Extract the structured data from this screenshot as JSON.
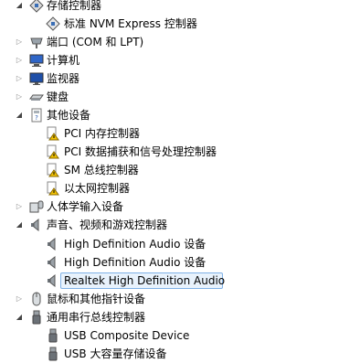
{
  "tree": {
    "storage_controllers": {
      "label": "存储控制器"
    },
    "nvme_controller": {
      "label": "标准 NVM Express 控制器"
    },
    "ports": {
      "label": "端口 (COM 和 LPT)"
    },
    "computer": {
      "label": "计算机"
    },
    "monitors": {
      "label": "监视器"
    },
    "keyboards": {
      "label": "键盘"
    },
    "other_devices": {
      "label": "其他设备"
    },
    "pci_memory": {
      "label": "PCI 内存控制器"
    },
    "pci_data_acq": {
      "label": "PCI 数据捕获和信号处理控制器"
    },
    "sm_bus": {
      "label": "SM 总线控制器"
    },
    "ethernet": {
      "label": "以太网控制器"
    },
    "hid": {
      "label": "人体学输入设备"
    },
    "sound": {
      "label": "声音、视频和游戏控制器"
    },
    "hda_1": {
      "label": "High Definition Audio 设备"
    },
    "hda_2": {
      "label": "High Definition Audio 设备"
    },
    "realtek": {
      "label": "Realtek High Definition Audio"
    },
    "mice": {
      "label": "鼠标和其他指针设备"
    },
    "usb_controllers": {
      "label": "通用串行总线控制器"
    },
    "usb_composite": {
      "label": "USB Composite Device"
    },
    "usb_mass_storage": {
      "label": "USB 大容量存储设备"
    }
  },
  "colors": {
    "selection_fill": "#e8f2fc",
    "selection_border": "#7fb1e6",
    "warning": "#f2c200"
  },
  "icons": [
    "storage-controller-icon",
    "controller-icon",
    "port-icon",
    "computer-icon",
    "monitor-icon",
    "keyboard-icon",
    "unknown-device-icon",
    "warning-device-icon",
    "hid-icon",
    "speaker-icon",
    "mouse-icon",
    "usb-icon"
  ]
}
